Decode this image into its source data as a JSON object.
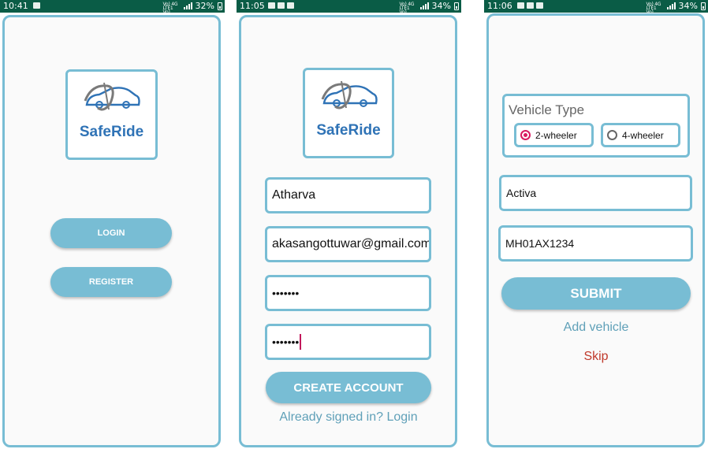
{
  "colors": {
    "accent": "#78bdd4",
    "status_bar": "#0a5c46",
    "brand_blue": "#2f73b6",
    "link": "#5fa0b8",
    "skip": "#c0392b",
    "radio_checked": "#d81b60"
  },
  "screen1": {
    "status": {
      "time": "10:41",
      "battery": "32%",
      "network": "Vo) 4G LTE1 Vo) LTE2"
    },
    "logo": {
      "brand": "SafeRide",
      "icon": "car-with-orbit-icon"
    },
    "login_label": "LOGIN",
    "register_label": "REGISTER"
  },
  "screen2": {
    "status": {
      "time": "11:05",
      "battery": "34%",
      "network": "Vo) 4G LTE1 Vo) LTE2"
    },
    "logo": {
      "brand": "SafeRide",
      "icon": "car-with-orbit-icon"
    },
    "name_value": "Atharva",
    "email_value": "akasangottuwar@gmail.com",
    "password_value": "•••••••",
    "confirm_password_value": "•••••••",
    "create_account_label": "CREATE ACCOUNT",
    "login_link": "Already signed in? Login"
  },
  "screen3": {
    "status": {
      "time": "11:06",
      "battery": "34%",
      "network": "Vo) 4G LTE1 Vo) LTE2"
    },
    "vehicle_type_label": "Vehicle Type",
    "options": [
      {
        "label": "2-wheeler",
        "checked": true
      },
      {
        "label": "4-wheeler",
        "checked": false
      }
    ],
    "vehicle_name_value": "Activa",
    "vehicle_number_value": "MH01AX1234",
    "submit_label": "SUBMIT",
    "add_vehicle_label": "Add vehicle",
    "skip_label": "Skip"
  }
}
